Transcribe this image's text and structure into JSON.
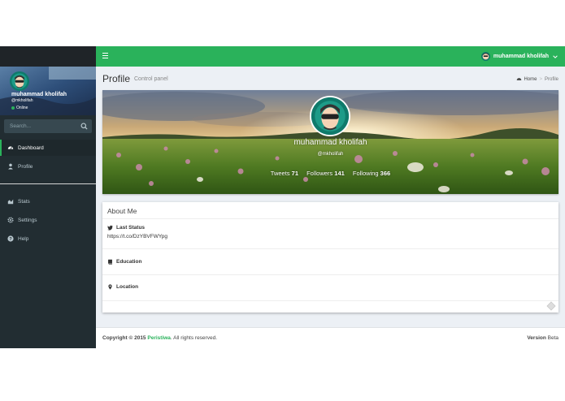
{
  "colors": {
    "accent": "#2ab25b",
    "sidebar": "#222d32",
    "content_bg": "#ecf0f5"
  },
  "navbar": {
    "menu_icon": "hamburger-icon",
    "user_name": "muhammad kholifah",
    "caret_icon": "chevron-down-icon"
  },
  "sidebar": {
    "user": {
      "name": "muhammad kholifah",
      "handle": "@mkholifah",
      "status": "Online"
    },
    "search": {
      "placeholder": "Search...",
      "icon": "search-icon"
    },
    "items": [
      {
        "label": "Dashboard",
        "icon": "dashboard-icon",
        "active": true
      },
      {
        "label": "Profile",
        "icon": "user-icon",
        "active": false
      },
      {
        "label": "Stats",
        "icon": "area-chart-icon",
        "active": false
      },
      {
        "label": "Settings",
        "icon": "gear-icon",
        "active": false
      },
      {
        "label": "Help",
        "icon": "question-circle-icon",
        "active": false
      }
    ]
  },
  "header": {
    "title": "Profile",
    "subtitle": "Control panel"
  },
  "breadcrumb": {
    "home": "Home",
    "separator": ">",
    "current": "Profile"
  },
  "profile": {
    "name": "muhammad kholifah",
    "handle": "@mkholifah",
    "tweets_label": "Tweets",
    "tweets": "71",
    "followers_label": "Followers",
    "followers": "141",
    "following_label": "Following",
    "following": "366"
  },
  "about": {
    "title": "About Me",
    "last_status_label": "Last Status",
    "last_status_value": "https://t.co/DzYBVFWYpg",
    "education_label": "Education",
    "location_label": "Location"
  },
  "footer": {
    "copyright_prefix": "Copyright © 2015",
    "brand": "Peristiwa",
    "suffix": ". All rights reserved.",
    "version_label": "Version",
    "version_value": "Beta"
  }
}
